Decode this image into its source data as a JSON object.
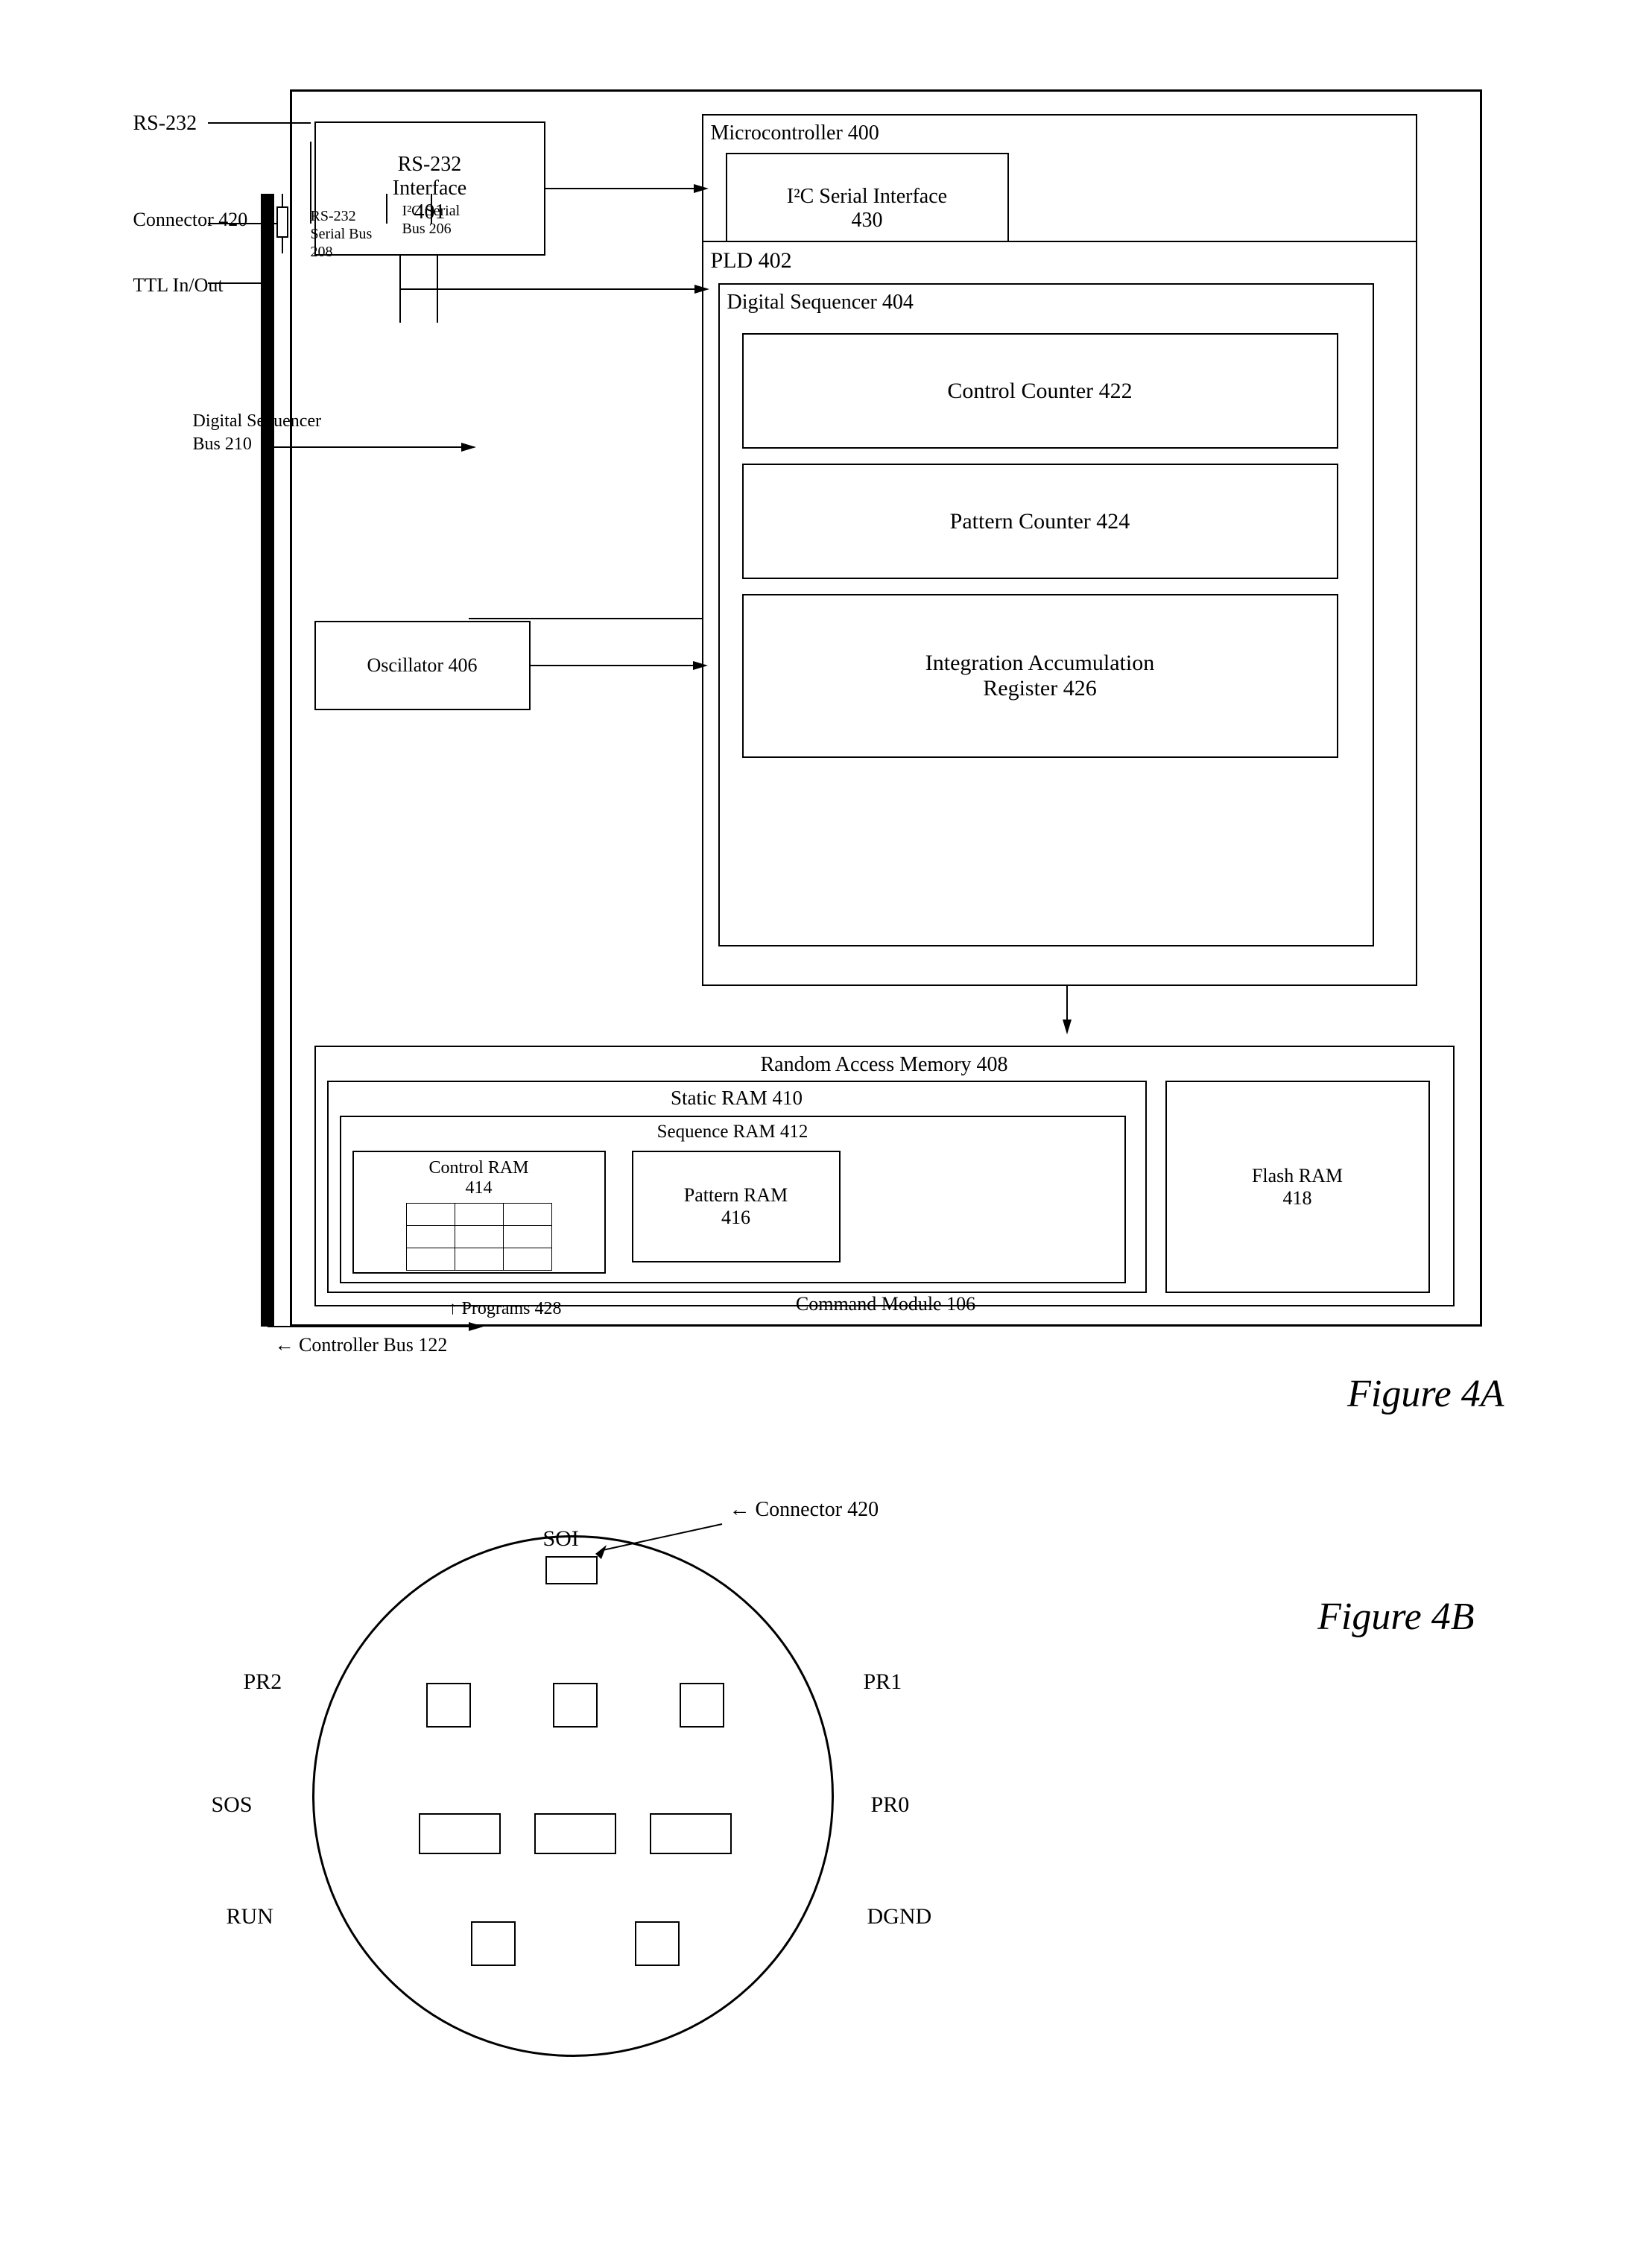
{
  "fig4a": {
    "title": "Figure 4A",
    "rs232_label": "RS-232",
    "connector_label": "Connector 420",
    "ttl_label": "TTL In/Out",
    "rs232_interface": "RS-232\nInterface\n401",
    "microcontroller": "Microcontroller 400",
    "i2c": "I²C Serial Interface\n430",
    "pld": "PLD 402",
    "digital_sequencer": "Digital Sequencer 404",
    "control_counter": "Control Counter 422",
    "pattern_counter": "Pattern Counter 424",
    "integration": "Integration Accumulation\nRegister 426",
    "oscillator": "Oscillator 406",
    "ram_outer": "Random Access Memory 408",
    "static_ram": "Static RAM 410",
    "sequence_ram": "Sequence RAM 412",
    "control_ram": "Control RAM\n414",
    "pattern_ram": "Pattern RAM\n416",
    "flash_ram": "Flash RAM\n418",
    "rs232_bus": "RS-232\nSerial Bus\n208",
    "i2c_bus": "I²C Serial\nBus 206",
    "dig_seq_bus": "Digital Sequencer\nBus 210",
    "programs": "Programs 428",
    "controller_bus": "Controller Bus 122",
    "command_module": "Command Module 106"
  },
  "fig4b": {
    "title": "Figure 4B",
    "connector_label": "Connector 420",
    "soi": "SOI",
    "pr2": "PR2",
    "pr1": "PR1",
    "sos": "SOS",
    "pr0": "PR0",
    "run": "RUN",
    "dgnd": "DGND"
  }
}
